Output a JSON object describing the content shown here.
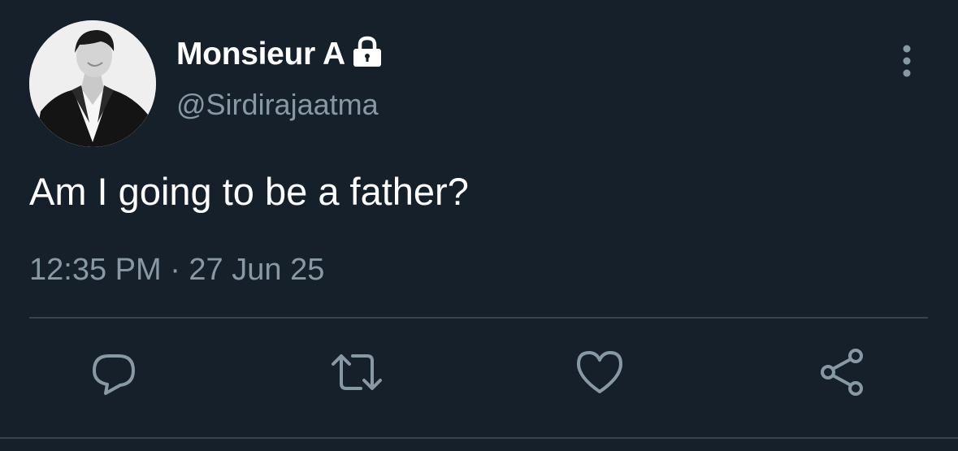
{
  "colors": {
    "background": "#15202b",
    "text_primary": "#ffffff",
    "text_secondary": "#8899a6",
    "divider": "#38444d",
    "icon": "#8899a6"
  },
  "tweet": {
    "display_name": "Monsieur A",
    "protected_icon": "lock-icon",
    "handle": "@Sirdirajaatma",
    "text": "Am I going to be a father?",
    "timestamp": "12:35 PM · 27 Jun 25"
  },
  "actions": [
    {
      "name": "reply",
      "icon": "reply-icon"
    },
    {
      "name": "retweet",
      "icon": "retweet-icon"
    },
    {
      "name": "like",
      "icon": "heart-icon"
    },
    {
      "name": "share",
      "icon": "share-icon"
    }
  ],
  "menu_icon": "more-vertical-icon"
}
